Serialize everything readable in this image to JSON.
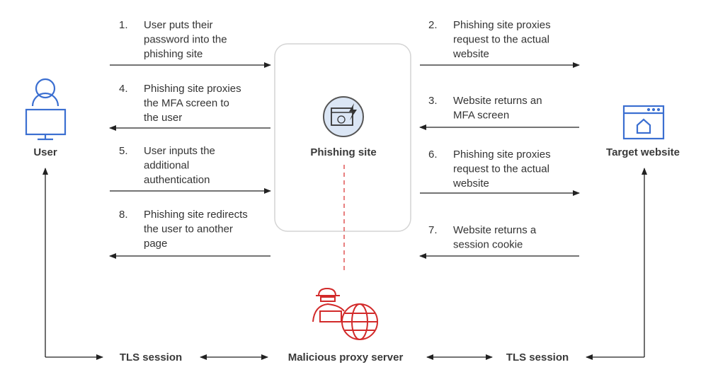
{
  "actors": {
    "user": "User",
    "phishing_site": "Phishing site",
    "target_website": "Target website",
    "proxy_server": "Malicious proxy server"
  },
  "steps_left": [
    {
      "num": "1.",
      "lines": [
        "User puts their",
        "password into the",
        "phishing site"
      ],
      "direction": "right"
    },
    {
      "num": "4.",
      "lines": [
        "Phishing site proxies",
        "the MFA screen to",
        "the user"
      ],
      "direction": "left"
    },
    {
      "num": "5.",
      "lines": [
        "User inputs the",
        "additional",
        "authentication"
      ],
      "direction": "right"
    },
    {
      "num": "8.",
      "lines": [
        "Phishing site redirects",
        "the user to another",
        "page"
      ],
      "direction": "left"
    }
  ],
  "steps_right": [
    {
      "num": "2.",
      "lines": [
        "Phishing site proxies",
        "request to the actual",
        "website"
      ],
      "direction": "right"
    },
    {
      "num": "3.",
      "lines": [
        "Website returns an",
        "MFA screen"
      ],
      "direction": "left"
    },
    {
      "num": "6.",
      "lines": [
        "Phishing site proxies",
        "request to the actual",
        "website"
      ],
      "direction": "right"
    },
    {
      "num": "7.",
      "lines": [
        "Website returns a",
        "session cookie"
      ],
      "direction": "left"
    }
  ],
  "bottom": {
    "tls_left": "TLS session",
    "tls_right": "TLS session"
  },
  "colors": {
    "user_blue": "#3b6fd1",
    "malicious_red": "#d22a2a",
    "phish_icon_fill": "#dbe6f5",
    "text": "#333333"
  },
  "icons": {
    "user": "user-at-computer-icon",
    "phishing": "phishing-browser-icon",
    "target": "browser-home-icon",
    "proxy": "hacker-globe-icon"
  }
}
